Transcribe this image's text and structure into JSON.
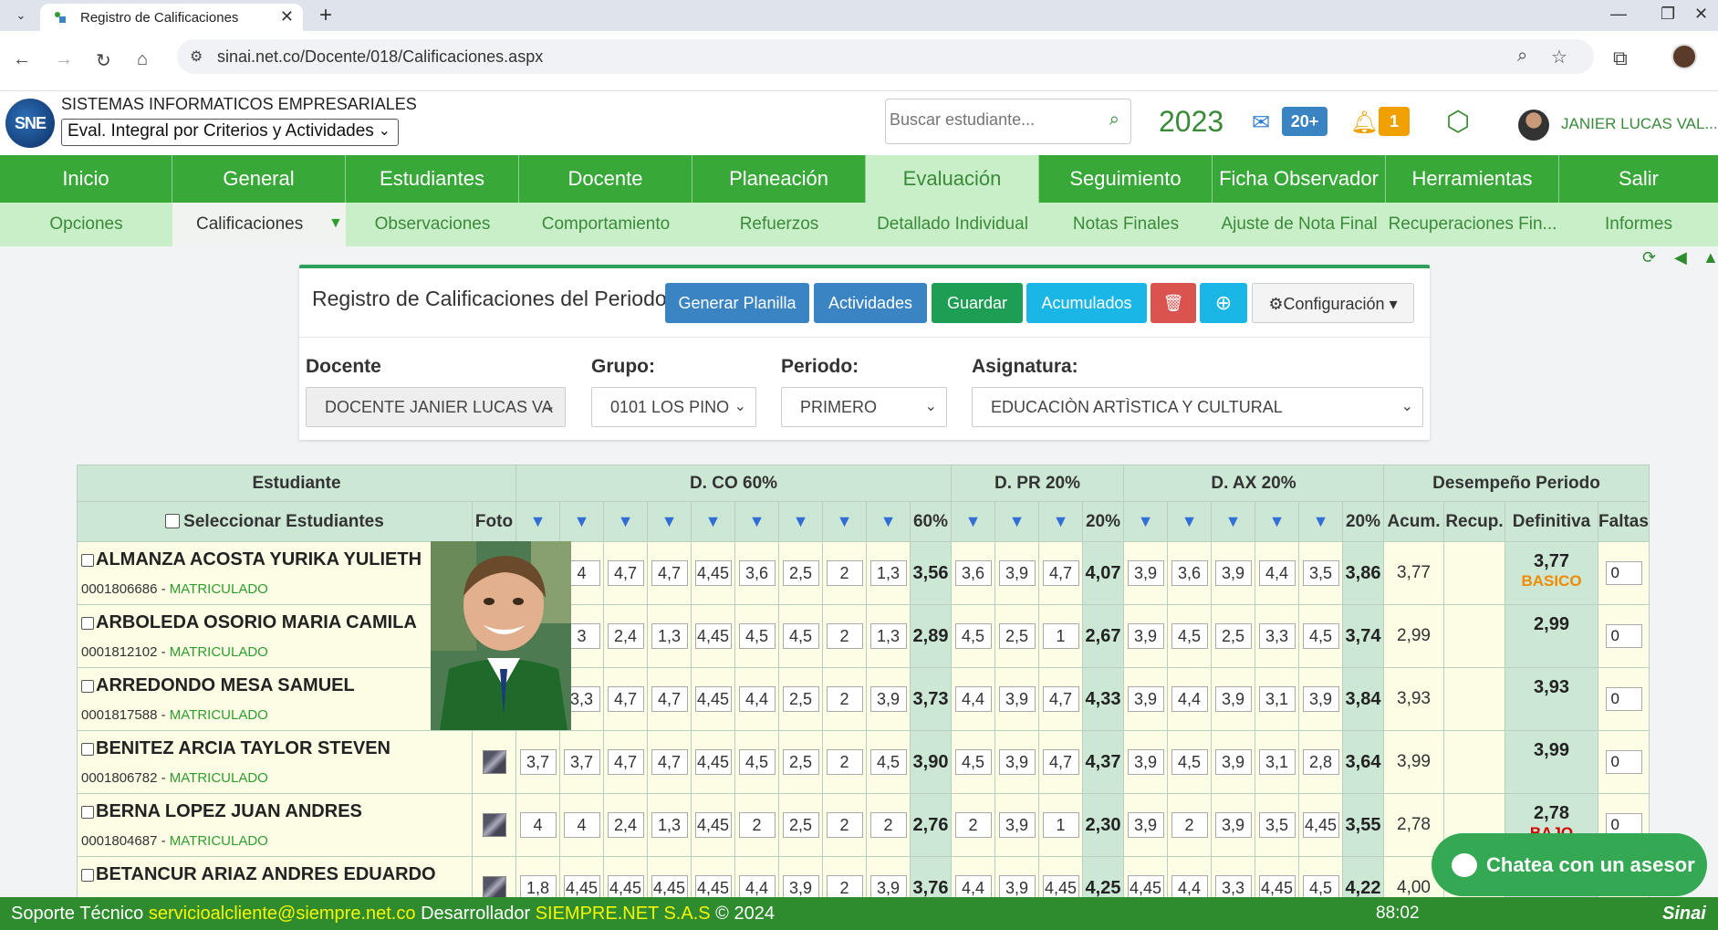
{
  "browser": {
    "tab_title": "Registro de Calificaciones",
    "url": "sinai.net.co/Docente/018/Calificaciones.aspx"
  },
  "header": {
    "logo_text": "SNE",
    "company": "SISTEMAS INFORMATICOS EMPRESARIALES",
    "eval_select": "Eval. Integral por Criterios y Actividades",
    "search_placeholder": "Buscar estudiante...",
    "year": "2023",
    "mail_badge": "20+",
    "bell_badge": "1",
    "user_name": "JANIER LUCAS VAL..."
  },
  "mainnav": [
    "Inicio",
    "General",
    "Estudiantes",
    "Docente",
    "Planeación",
    "Evaluación",
    "Seguimiento",
    "Ficha Observador",
    "Herramientas",
    "Salir"
  ],
  "subnav": [
    "Opciones",
    "Calificaciones",
    "Observaciones",
    "Comportamiento",
    "Refuerzos",
    "Detallado Individual",
    "Notas Finales",
    "Ajuste de Nota Final",
    "Recuperaciones Fin...",
    "Informes"
  ],
  "panel": {
    "title": "Registro de Calificaciones del Periodo",
    "buttons": {
      "generar": "Generar Planilla",
      "actividades": "Actividades",
      "guardar": "Guardar",
      "acumulados": "Acumulados",
      "config": "Configuración"
    },
    "filters": {
      "docente_label": "Docente",
      "docente_value": "DOCENTE JANIER LUCAS VA",
      "grupo_label": "Grupo:",
      "grupo_value": "0101 LOS PINO",
      "periodo_label": "Periodo:",
      "periodo_value": "PRIMERO",
      "asignatura_label": "Asignatura:",
      "asignatura_value": "EDUCACIÒN ARTÌSTICA Y CULTURAL"
    }
  },
  "table": {
    "group_headers": {
      "estudiante": "Estudiante",
      "dco": "D. CO 60%",
      "dpr": "D. PR 20%",
      "dax": "D. AX 20%",
      "desempeno": "Desempeño Periodo"
    },
    "sub_headers": {
      "select": "Seleccionar Estudiantes",
      "foto": "Foto",
      "arrow": "▼",
      "co_pct": "60%",
      "pr_pct": "20%",
      "ax_pct": "20%",
      "acum": "Acum.",
      "recup": "Recup.",
      "definitiva": "Definitiva",
      "faltas": "Faltas"
    },
    "rows": [
      {
        "name": "ALMANZA ACOSTA YURIKA YULIETH",
        "code": "0001806686",
        "status": "MATRICULADO",
        "co": [
          "4",
          "4",
          "4,7",
          "4,7",
          "4,45",
          "3,6",
          "2,5",
          "2",
          "1,3"
        ],
        "co_t": "3,56",
        "pr": [
          "3,6",
          "3,9",
          "4,7"
        ],
        "pr_t": "4,07",
        "ax": [
          "3,9",
          "3,6",
          "3,9",
          "4,4",
          "3,5"
        ],
        "ax_t": "3,86",
        "acum": "3,77",
        "definitiva": "3,77",
        "nivel": "BASICO",
        "nivel_color": "#f08a00",
        "faltas": "0"
      },
      {
        "name": "ARBOLEDA OSORIO MARIA CAMILA",
        "code": "0001812102",
        "status": "MATRICULADO",
        "co": [
          "3",
          "3",
          "2,4",
          "1,3",
          "4,45",
          "4,5",
          "4,5",
          "2",
          "1,3"
        ],
        "co_t": "2,89",
        "pr": [
          "4,5",
          "2,5",
          "1"
        ],
        "pr_t": "2,67",
        "ax": [
          "3,9",
          "4,5",
          "2,5",
          "3,3",
          "4,5"
        ],
        "ax_t": "3,74",
        "acum": "2,99",
        "definitiva": "2,99",
        "nivel": "",
        "nivel_color": "#222",
        "faltas": "0"
      },
      {
        "name": "ARREDONDO MESA SAMUEL",
        "code": "0001817588",
        "status": "MATRICULADO",
        "co": [
          "3,3",
          "3,3",
          "4,7",
          "4,7",
          "4,45",
          "4,4",
          "2,5",
          "2",
          "3,9"
        ],
        "co_t": "3,73",
        "pr": [
          "4,4",
          "3,9",
          "4,7"
        ],
        "pr_t": "4,33",
        "ax": [
          "3,9",
          "4,4",
          "3,9",
          "3,1",
          "3,9"
        ],
        "ax_t": "3,84",
        "acum": "3,93",
        "definitiva": "3,93",
        "nivel": "",
        "nivel_color": "#222",
        "faltas": "0"
      },
      {
        "name": "BENITEZ ARCIA TAYLOR STEVEN",
        "code": "0001806782",
        "status": "MATRICULADO",
        "co": [
          "3,7",
          "3,7",
          "4,7",
          "4,7",
          "4,45",
          "4,5",
          "2,5",
          "2",
          "4,5"
        ],
        "co_t": "3,90",
        "pr": [
          "4,5",
          "3,9",
          "4,7"
        ],
        "pr_t": "4,37",
        "ax": [
          "3,9",
          "4,5",
          "3,9",
          "3,1",
          "2,8"
        ],
        "ax_t": "3,64",
        "acum": "3,99",
        "definitiva": "3,99",
        "nivel": "",
        "nivel_color": "#222",
        "faltas": "0"
      },
      {
        "name": "BERNA LOPEZ JUAN ANDRES",
        "code": "0001804687",
        "status": "MATRICULADO",
        "co": [
          "4",
          "4",
          "2,4",
          "1,3",
          "4,45",
          "2",
          "2,5",
          "2",
          "2"
        ],
        "co_t": "2,76",
        "pr": [
          "2",
          "3,9",
          "1"
        ],
        "pr_t": "2,30",
        "ax": [
          "3,9",
          "2",
          "3,9",
          "3,5",
          "4,45"
        ],
        "ax_t": "3,55",
        "acum": "2,78",
        "definitiva": "2,78",
        "nivel": "BAJO",
        "nivel_color": "#d00000",
        "faltas": "0"
      },
      {
        "name": "BETANCUR ARIAZ ANDRES EDUARDO",
        "code": "",
        "status": "",
        "co": [
          "1,8",
          "4,45",
          "4,45",
          "4,45",
          "4,45",
          "4,4",
          "3,9",
          "2",
          "3,9"
        ],
        "co_t": "3,76",
        "pr": [
          "4,4",
          "3,9",
          "4,45"
        ],
        "pr_t": "4,25",
        "ax": [
          "4,45",
          "4,4",
          "3,3",
          "4,45",
          "4,5"
        ],
        "ax_t": "4,22",
        "acum": "4,00",
        "definitiva": "",
        "nivel": "",
        "nivel_color": "#222",
        "faltas": ""
      }
    ]
  },
  "chat": "Chatea con un asesor",
  "footer": {
    "support_label": "Soporte Técnico",
    "email": "servicioalcliente@siempre.net.co",
    "dev_label": "Desarrollador",
    "dev_name": "SIEMPRE.NET S.A.S",
    "copyright": "© 2024",
    "timer": "88:02",
    "brand": "Sinai"
  }
}
